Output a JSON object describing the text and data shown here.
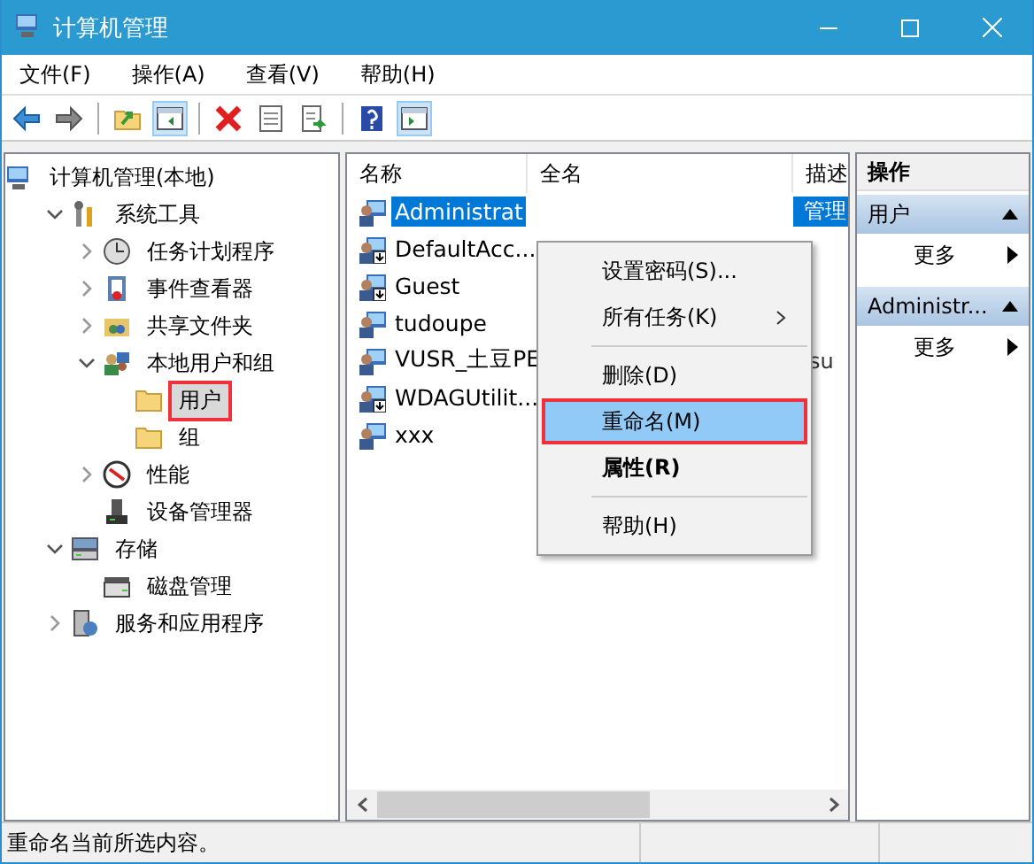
{
  "window": {
    "title": "计算机管理"
  },
  "menu_bar": [
    "文件(F)",
    "操作(A)",
    "查看(V)",
    "帮助(H)"
  ],
  "tree": [
    {
      "label": "计算机管理(本地)",
      "selected": false,
      "annotated": false,
      "children": [
        {
          "label": "系统工具",
          "expanded": true,
          "selected": false,
          "annotated": false,
          "children": [
            {
              "label": "任务计划程序",
              "expanded": false,
              "selected": false,
              "annotated": false
            },
            {
              "label": "事件查看器",
              "expanded": false,
              "selected": false,
              "annotated": false
            },
            {
              "label": "共享文件夹",
              "expanded": false,
              "selected": false,
              "annotated": false
            },
            {
              "label": "本地用户和组",
              "expanded": true,
              "selected": false,
              "annotated": false,
              "children": [
                {
                  "label": "用户",
                  "selected": true,
                  "annotated": true
                },
                {
                  "label": "组",
                  "selected": false,
                  "annotated": false
                }
              ]
            },
            {
              "label": "性能",
              "expanded": false,
              "selected": false,
              "annotated": false
            },
            {
              "label": "设备管理器",
              "selected": false,
              "annotated": false
            }
          ]
        },
        {
          "label": "存储",
          "expanded": true,
          "selected": false,
          "annotated": false,
          "children": [
            {
              "label": "磁盘管理",
              "selected": false,
              "annotated": false
            }
          ]
        },
        {
          "label": "服务和应用程序",
          "expanded": false,
          "selected": false,
          "annotated": false
        }
      ]
    }
  ],
  "table": {
    "columns": [
      "名称",
      "全名",
      "描述"
    ],
    "rows": [
      {
        "name": "Administrat",
        "description": "管理",
        "selected": true,
        "disabled": false
      },
      {
        "name": "DefaultAcc...",
        "selected": false,
        "disabled": true
      },
      {
        "name": "Guest",
        "selected": false,
        "disabled": true
      },
      {
        "name": "tudoupe",
        "selected": false,
        "disabled": false
      },
      {
        "name": "VUSR_土豆PE",
        "description": "su",
        "selected": false,
        "disabled": false
      },
      {
        "name": "WDAGUtilit...",
        "selected": false,
        "disabled": true
      },
      {
        "name": "xxx",
        "selected": false,
        "disabled": false
      }
    ]
  },
  "context_menu": [
    {
      "kind": "item",
      "label": "设置密码(S)...",
      "submenu": false,
      "bold": false,
      "highlighted": false,
      "annotated": false
    },
    {
      "kind": "item",
      "label": "所有任务(K)",
      "submenu": true,
      "bold": false,
      "highlighted": false,
      "annotated": false
    },
    {
      "kind": "separator"
    },
    {
      "kind": "item",
      "label": "删除(D)",
      "submenu": false,
      "bold": false,
      "highlighted": false,
      "annotated": false
    },
    {
      "kind": "item",
      "label": "重命名(M)",
      "submenu": false,
      "bold": false,
      "highlighted": true,
      "annotated": true
    },
    {
      "kind": "item",
      "label": "属性(R)",
      "submenu": false,
      "bold": true,
      "highlighted": false,
      "annotated": false
    },
    {
      "kind": "separator"
    },
    {
      "kind": "item",
      "label": "帮助(H)",
      "submenu": false,
      "bold": false,
      "highlighted": false,
      "annotated": false
    }
  ],
  "actions": {
    "title": "操作",
    "sections": [
      {
        "title": "用户",
        "items": [
          "更多"
        ]
      },
      {
        "title": "Administr...",
        "items": [
          "更多"
        ]
      }
    ]
  },
  "status_bar": {
    "text": "重命名当前所选内容。"
  }
}
